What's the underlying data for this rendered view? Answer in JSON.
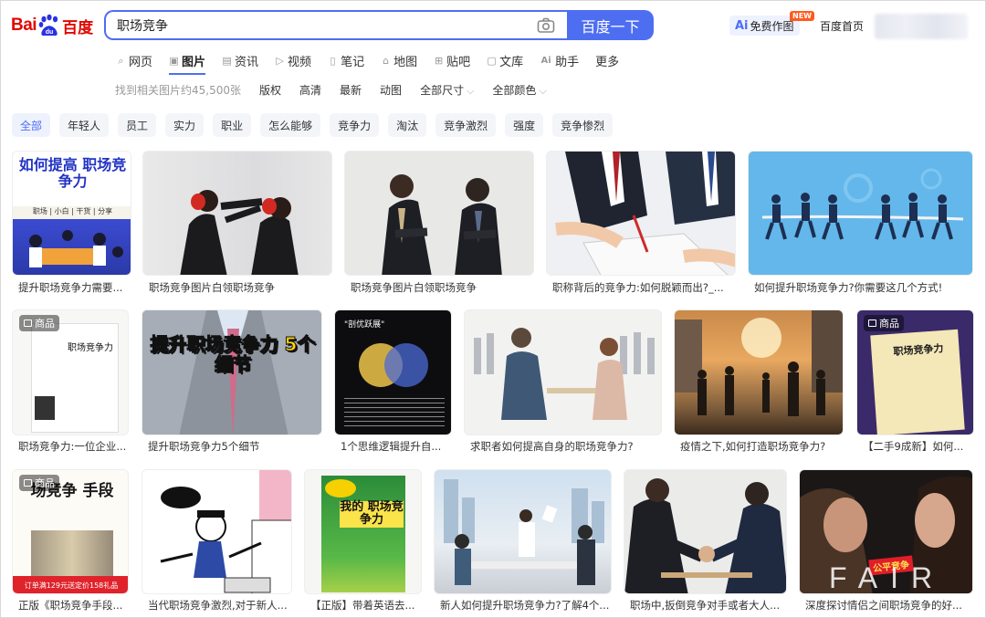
{
  "header": {
    "logo": {
      "bai": "Bai",
      "du": "du",
      "cn": "百度"
    },
    "search": {
      "value": "职场竞争",
      "button_label": "百度一下"
    },
    "ai_draw": {
      "prefix": "Ai",
      "label": "免费作图",
      "badge": "NEW"
    },
    "home_link": "百度首页"
  },
  "nav": {
    "tabs": [
      {
        "label": "网页",
        "icon": "search-icon"
      },
      {
        "label": "图片",
        "icon": "image-icon",
        "active": true
      },
      {
        "label": "资讯",
        "icon": "news-icon"
      },
      {
        "label": "视频",
        "icon": "video-icon"
      },
      {
        "label": "笔记",
        "icon": "note-icon"
      },
      {
        "label": "地图",
        "icon": "map-pin-icon"
      },
      {
        "label": "贴吧",
        "icon": "tieba-icon"
      },
      {
        "label": "文库",
        "icon": "document-icon"
      },
      {
        "label": "助手",
        "icon": "ai-icon"
      },
      {
        "label": "更多",
        "icon": ""
      }
    ]
  },
  "filters": {
    "count_text": "找到相关图片约45,500张",
    "copyright": "版权",
    "hd": "高清",
    "latest": "最新",
    "animated": "动图",
    "size": "全部尺寸",
    "color": "全部颜色"
  },
  "chips": [
    "全部",
    "年轻人",
    "员工",
    "实力",
    "职业",
    "怎么能够",
    "竞争力",
    "淘汰",
    "竞争激烈",
    "强度",
    "竞争惨烈"
  ],
  "results": {
    "product_badge": "商品",
    "row1": [
      {
        "caption": "提升职场竞争力需要...",
        "overlay": "如何提高 职场竞争力",
        "sub": "职场 | 小白 | 干货 | 分享"
      },
      {
        "caption": "职场竞争图片白领职场竞争"
      },
      {
        "caption": "职场竞争图片白领职场竞争"
      },
      {
        "caption": "职称背后的竞争力:如何脱颖而出?_..."
      },
      {
        "caption": "如何提升职场竞争力?你需要这几个方式!"
      }
    ],
    "row2": [
      {
        "caption": "职场竞争力:一位企业...",
        "overlay": "职场竞争力"
      },
      {
        "caption": "提升职场竞争力5个细节",
        "overlay": "提升职场竞争力 5个细节"
      },
      {
        "caption": "1个思维逻辑提升自...",
        "overlay": "\"剖优跃展\""
      },
      {
        "caption": "求职者如何提高自身的职场竞争力?"
      },
      {
        "caption": "疫情之下,如何打造职场竞争力?"
      },
      {
        "caption": "【二手9成新】如何...",
        "overlay": "职场竞争力"
      }
    ],
    "row3": [
      {
        "caption": "正版《职场竞争手段...",
        "overlay": "场竞争 手段",
        "promo": "订单满129元送定价158礼品"
      },
      {
        "caption": "当代职场竞争激烈,对于新人..."
      },
      {
        "caption": "【正版】带着英语去...",
        "overlay": "我的 职场竞争力"
      },
      {
        "caption": "新人如何提升职场竞争力?了解4个..."
      },
      {
        "caption": "职场中,扳倒竞争对手或者大人..."
      },
      {
        "caption": "深度探讨情侣之间职场竞争的好...",
        "overlay": "公平竞争",
        "big": "FAIR"
      }
    ]
  }
}
